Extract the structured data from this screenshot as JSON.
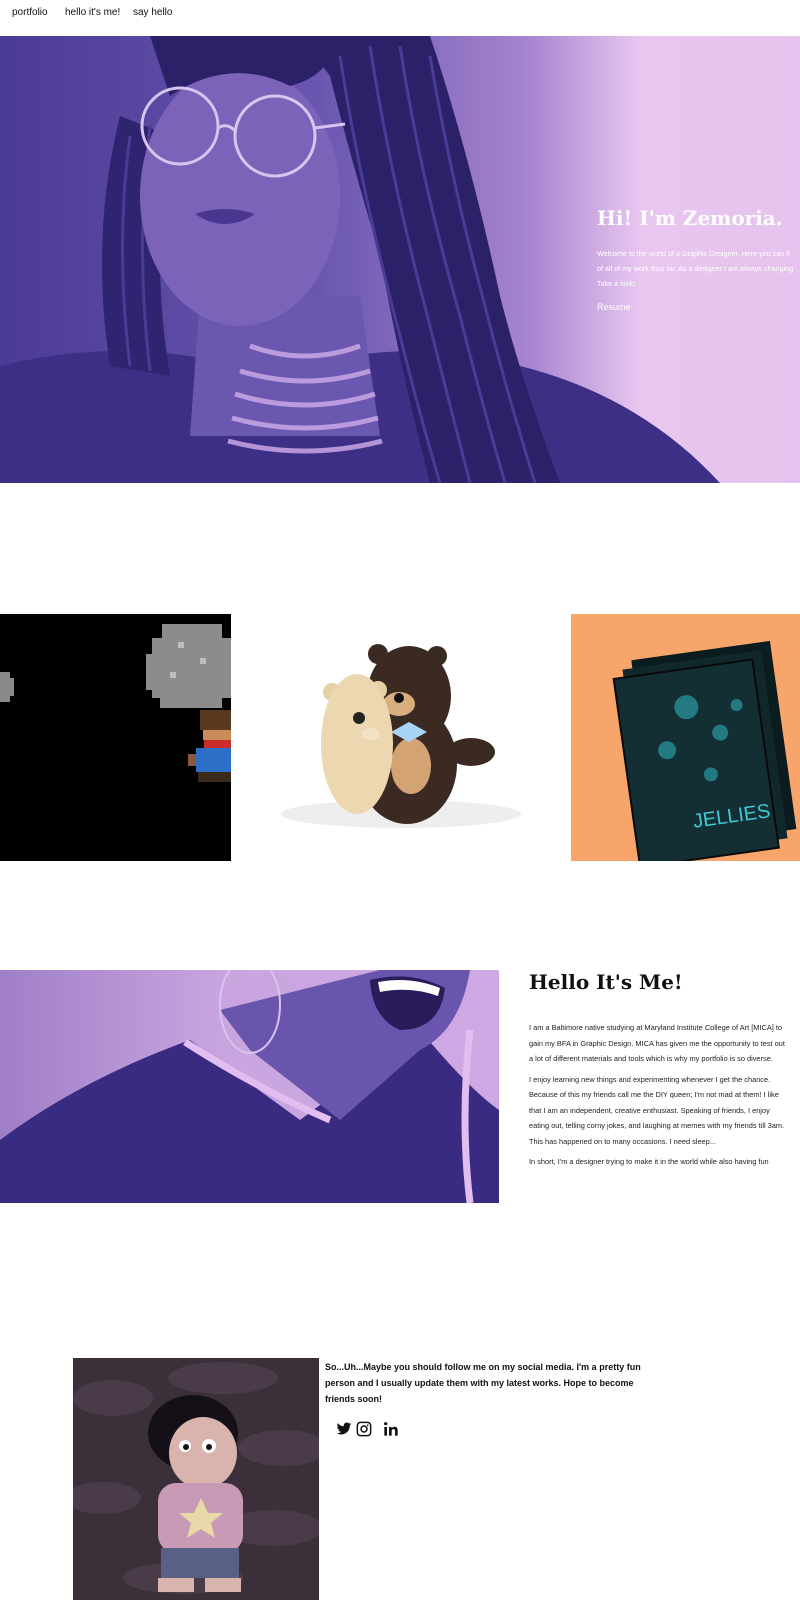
{
  "nav": {
    "items": [
      "portfolio",
      "hello it's me!",
      "say hello"
    ]
  },
  "hero": {
    "title": "Hi! I'm Zemoria.",
    "description": "Welcome to the world of a Graphic Designer. Here you can fi\nof all of my work thus far. As a designer I am always changing\nTake a look!",
    "resume_label": "Resume"
  },
  "portfolio": {
    "tiles": [
      {
        "name": "pixel-game-art"
      },
      {
        "name": "plush-bears"
      },
      {
        "name": "jellies-book",
        "text": "JELLIES"
      }
    ]
  },
  "about": {
    "title": "Hello It's Me!",
    "paragraphs": [
      "I am a Baltimore native studying at Maryland Institute College of Art [MICA] to gain my BFA in Graphic Design. MICA has given me the opportunity to test out a lot of different materials and tools which is why my portfolio is so diverse.",
      "I enjoy learning new things and experimenting whenever I get the chance. Because of this my friends call me the DIY queen; I'm not mad at them! I like that I am an independent, creative enthusiast. Speaking of friends, I enjoy eating out, telling corny jokes, and laughing at memes with my friends till 3am. This has happened on to many occasions. I need sleep...",
      "In short, I'm a designer trying to make it in the world while also having fun"
    ]
  },
  "social": {
    "text": "So...Uh...Maybe you should follow me on my social media. I'm a pretty fun person and I usually update them with my latest works. Hope to become friends soon!",
    "icons": [
      "twitter-icon",
      "instagram-icon",
      "linkedin-icon"
    ]
  },
  "colors": {
    "hero_purple_dark": "#3f2f8c",
    "hero_purple_light": "#e6c3ee",
    "tile_orange": "#f8a56b",
    "jellies_teal": "#3fc9d4"
  }
}
